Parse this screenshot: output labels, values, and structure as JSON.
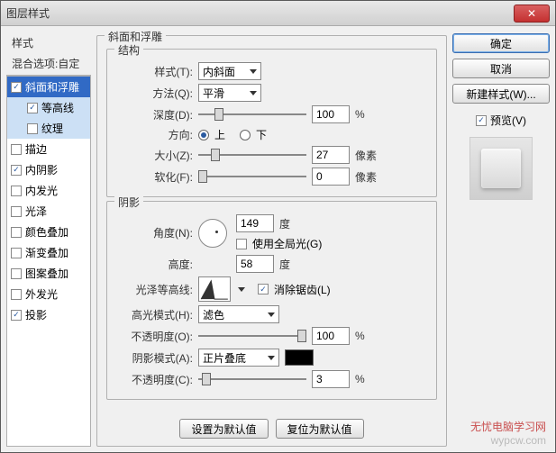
{
  "window": {
    "title": "图层样式"
  },
  "left": {
    "styles_header": "样式",
    "blend_header": "混合选项:自定",
    "items": [
      {
        "label": "斜面和浮雕",
        "checked": true,
        "selected": true
      },
      {
        "label": "等高线",
        "checked": true,
        "sub": true
      },
      {
        "label": "纹理",
        "checked": false,
        "sub": true
      },
      {
        "label": "描边",
        "checked": false
      },
      {
        "label": "内阴影",
        "checked": true
      },
      {
        "label": "内发光",
        "checked": false
      },
      {
        "label": "光泽",
        "checked": false
      },
      {
        "label": "颜色叠加",
        "checked": false
      },
      {
        "label": "渐变叠加",
        "checked": false
      },
      {
        "label": "图案叠加",
        "checked": false
      },
      {
        "label": "外发光",
        "checked": false
      },
      {
        "label": "投影",
        "checked": true
      }
    ]
  },
  "center": {
    "panel_title": "斜面和浮雕",
    "structure": {
      "title": "结构",
      "style_label": "样式(T):",
      "style_value": "内斜面",
      "technique_label": "方法(Q):",
      "technique_value": "平滑",
      "depth_label": "深度(D):",
      "depth_value": "100",
      "depth_unit": "%",
      "direction_label": "方向:",
      "up_label": "上",
      "down_label": "下",
      "direction_value": "up",
      "size_label": "大小(Z):",
      "size_value": "27",
      "size_unit": "像素",
      "soften_label": "软化(F):",
      "soften_value": "0",
      "soften_unit": "像素"
    },
    "shading": {
      "title": "阴影",
      "angle_label": "角度(N):",
      "angle_value": "149",
      "angle_unit": "度",
      "global_label": "使用全局光(G)",
      "global_checked": false,
      "altitude_label": "高度:",
      "altitude_value": "58",
      "altitude_unit": "度",
      "gloss_label": "光泽等高线:",
      "antialias_label": "消除锯齿(L)",
      "antialias_checked": true,
      "highlight_mode_label": "高光模式(H):",
      "highlight_mode_value": "滤色",
      "highlight_opacity_label": "不透明度(O):",
      "highlight_opacity_value": "100",
      "highlight_opacity_unit": "%",
      "shadow_mode_label": "阴影模式(A):",
      "shadow_mode_value": "正片叠底",
      "shadow_color": "#000000",
      "shadow_opacity_label": "不透明度(C):",
      "shadow_opacity_value": "3",
      "shadow_opacity_unit": "%"
    },
    "buttons": {
      "default": "设置为默认值",
      "reset": "复位为默认值"
    }
  },
  "right": {
    "ok": "确定",
    "cancel": "取消",
    "new_style": "新建样式(W)...",
    "preview_label": "预览(V)",
    "preview_checked": true
  },
  "watermark": {
    "line1": "无忧电脑学习网",
    "line2": "wypcw.com"
  }
}
